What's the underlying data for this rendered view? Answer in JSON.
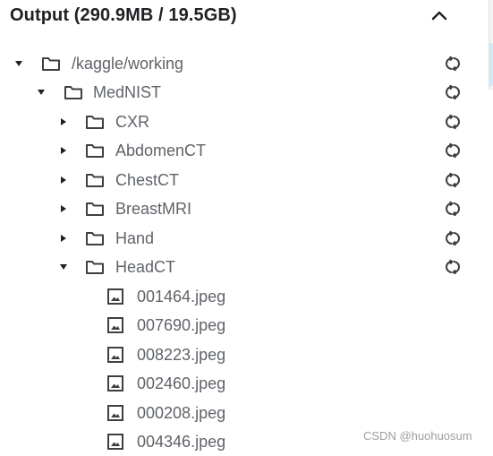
{
  "header": {
    "title": "Output (290.9MB / 19.5GB)"
  },
  "tree": {
    "root": {
      "label": "/kaggle/working"
    },
    "dataset": {
      "label": "MedNIST"
    },
    "folders": [
      {
        "label": "CXR"
      },
      {
        "label": "AbdomenCT"
      },
      {
        "label": "ChestCT"
      },
      {
        "label": "BreastMRI"
      },
      {
        "label": "Hand"
      },
      {
        "label": "HeadCT"
      }
    ],
    "files": [
      {
        "label": "001464.jpeg"
      },
      {
        "label": "007690.jpeg"
      },
      {
        "label": "008223.jpeg"
      },
      {
        "label": "002460.jpeg"
      },
      {
        "label": "000208.jpeg"
      },
      {
        "label": "004346.jpeg"
      }
    ]
  },
  "watermark": {
    "text": "CSDN @huohuosum"
  },
  "icons": {
    "collapse": "chevron-up-icon",
    "caret_open": "caret-down-icon",
    "caret_closed": "caret-right-icon",
    "folder": "folder-icon",
    "file": "image-file-icon",
    "refresh": "refresh-icon"
  },
  "colors": {
    "text": "#5f6368",
    "title": "#202124",
    "icon": "#3c4043"
  }
}
